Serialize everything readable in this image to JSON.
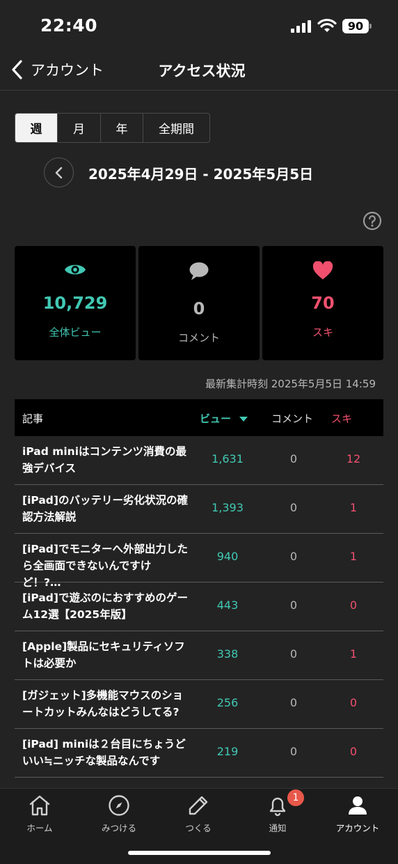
{
  "status_bar": {
    "time": "22:40",
    "battery": "90"
  },
  "nav": {
    "back_label": "アカウント",
    "title": "アクセス状況"
  },
  "period_tabs": [
    {
      "label": "週",
      "active": true
    },
    {
      "label": "月",
      "active": false
    },
    {
      "label": "年",
      "active": false
    },
    {
      "label": "全期間",
      "active": false
    }
  ],
  "date_range": "2025年4月29日 - 2025年5月5日",
  "stats": {
    "views": {
      "value": "10,729",
      "label": "全体ビュー",
      "icon": "eye-icon",
      "color": "#41c9b4"
    },
    "comments": {
      "value": "0",
      "label": "コメント",
      "icon": "speech-bubble-icon",
      "color": "#b8b8b8"
    },
    "likes": {
      "value": "70",
      "label": "スキ",
      "icon": "heart-icon",
      "color": "#f0506e"
    }
  },
  "updated_at": "最新集計時刻 2025年5月5日 14:59",
  "table": {
    "headers": {
      "article": "記事",
      "views": "ビュー",
      "comments": "コメント",
      "likes": "スキ"
    },
    "rows": [
      {
        "title": "iPad miniはコンテンツ消費の最強デバイス",
        "views": "1,631",
        "comments": "0",
        "likes": "12"
      },
      {
        "title": "[iPad]のバッテリー劣化状況の確認方法解説",
        "views": "1,393",
        "comments": "0",
        "likes": "1"
      },
      {
        "title": "[iPad]でモニターへ外部出力したら全画面できないんですけど！?…",
        "views": "940",
        "comments": "0",
        "likes": "1"
      },
      {
        "title": "[iPad]で遊ぶのにおすすめのゲーム12選【2025年版】",
        "views": "443",
        "comments": "0",
        "likes": "0"
      },
      {
        "title": "[Apple]製品にセキュリティソフトは必要か",
        "views": "338",
        "comments": "0",
        "likes": "1"
      },
      {
        "title": "[ガジェット]多機能マウスのショートカットみんなはどうしてる?",
        "views": "256",
        "comments": "0",
        "likes": "0"
      },
      {
        "title": "[iPad] miniは２台目にちょうどいい≒ニッチな製品なんです",
        "views": "219",
        "comments": "0",
        "likes": "0"
      }
    ]
  },
  "tabbar": {
    "items": [
      {
        "label": "ホーム",
        "icon": "home-icon"
      },
      {
        "label": "みつける",
        "icon": "compass-icon"
      },
      {
        "label": "つくる",
        "icon": "pencil-icon"
      },
      {
        "label": "通知",
        "icon": "bell-icon"
      },
      {
        "label": "アカウント",
        "icon": "person-icon"
      }
    ],
    "notification_badge": "1"
  },
  "colors": {
    "accent_view": "#41c9b4",
    "accent_like": "#f0506e",
    "background": "#232323"
  }
}
